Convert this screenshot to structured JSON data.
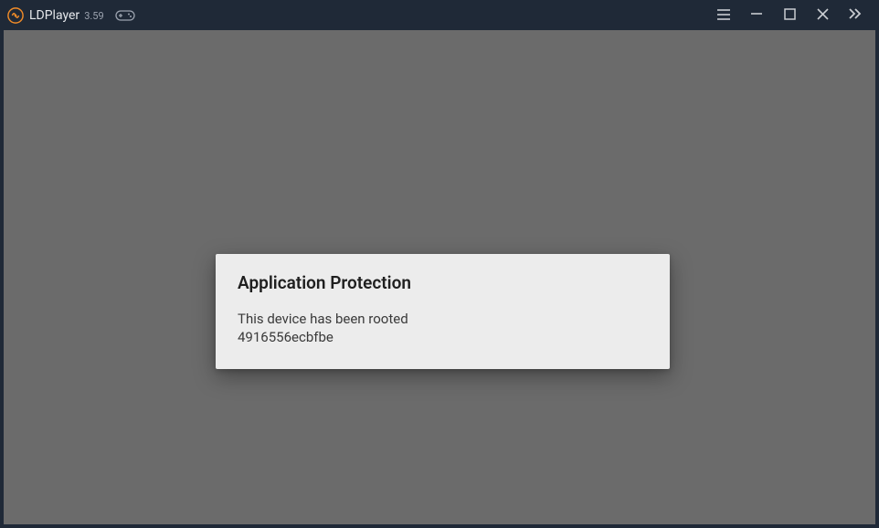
{
  "titlebar": {
    "appName": "LDPlayer",
    "version": "3.59"
  },
  "dialog": {
    "title": "Application Protection",
    "messageLine1": "This device has been rooted",
    "messageLine2": "4916556ecbfbe"
  },
  "colors": {
    "titlebarBg": "#1f2937",
    "contentBg": "#6b6b6b",
    "dialogBg": "#ececec",
    "accent": "#f28c28"
  }
}
